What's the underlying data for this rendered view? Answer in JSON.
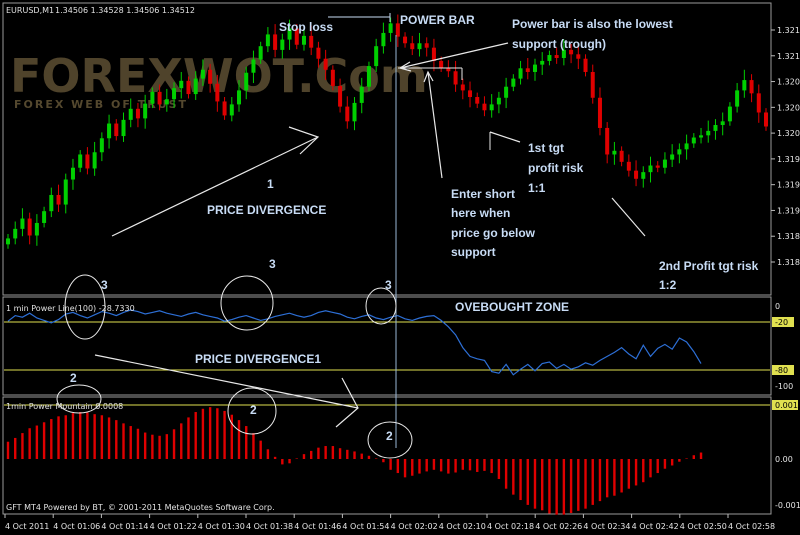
{
  "header": {
    "symbol": "EURUSD,M1",
    "ohlc": "1.34506 1.34528 1.34506 1.34512",
    "footer": "GFT MT4 Powered by BT, © 2001-2011 MetaQuotes Software Corp."
  },
  "watermark": {
    "main": "FOREXWOT.Com",
    "sub": "FOREX WEB OF TRUST"
  },
  "annotations": {
    "stop_loss": "Stop loss",
    "power_bar": "POWER BAR",
    "lowest_support_1": "Power bar is also the lowest",
    "lowest_support_2": "support (trough)",
    "first_tgt_1": "1st tgt",
    "first_tgt_2": "profit risk",
    "first_tgt_3": "1:1",
    "enter_1": "Enter short",
    "enter_2": "here when",
    "enter_3": "price go below",
    "enter_4": "support",
    "second_tgt_1": "2nd Profit tgt risk",
    "second_tgt_2": "1:2",
    "num_1": "1",
    "price_divergence": "PRICE DIVERGENCE",
    "num_3a": "3",
    "num_3b": "3",
    "num_3c": "3",
    "overbought": "OVEBOUGHT ZONE",
    "price_divergence1": "PRICE DIVERGENCE1",
    "num_2a": "2",
    "num_2b": "2",
    "num_2c": "2"
  },
  "chart_data": [
    {
      "type": "candlestick",
      "title": "EURUSD,M1",
      "x_ticks": [
        "4 Oct 2011",
        "4 Oct 01:06",
        "4 Oct 01:14",
        "4 Oct 01:22",
        "4 Oct 01:30",
        "4 Oct 01:38",
        "4 Oct 01:46",
        "4 Oct 01:54",
        "4 Oct 02:02",
        "4 Oct 02:10",
        "4 Oct 02:18",
        "4 Oct 02:26",
        "4 Oct 02:34",
        "4 Oct 02:42",
        "4 Oct 02:50",
        "4 Oct 02:58"
      ],
      "y_ticks": [
        "1.32145",
        "1.32110",
        "1.32075",
        "1.32040",
        "1.32005",
        "1.31970",
        "1.31935",
        "1.31900",
        "1.31865",
        "1.31830"
      ],
      "up_color": "#00d000",
      "down_color": "#e00000",
      "close": [
        1.31862,
        1.31875,
        1.31889,
        1.31866,
        1.31883,
        1.31899,
        1.31921,
        1.31908,
        1.31942,
        1.31958,
        1.31976,
        1.31957,
        1.31979,
        1.31998,
        1.32018,
        1.32001,
        1.32023,
        1.32038,
        1.32025,
        1.32045,
        1.32061,
        1.32044,
        1.32051,
        1.32066,
        1.32076,
        1.32058,
        1.32079,
        1.32091,
        1.32072,
        1.32048,
        1.32029,
        1.32044,
        1.32063,
        1.32087,
        1.32105,
        1.32123,
        1.32139,
        1.32118,
        1.32132,
        1.32147,
        1.32125,
        1.32137,
        1.32121,
        1.32106,
        1.32091,
        1.32069,
        1.32041,
        1.32021,
        1.32046,
        1.32068,
        1.32096,
        1.32123,
        1.32141,
        1.32154,
        1.32136,
        1.32127,
        1.32119,
        1.32127,
        1.32121,
        1.32103,
        1.32094,
        1.32089,
        1.32071,
        1.32063,
        1.32054,
        1.32045,
        1.32036,
        1.32044,
        1.32053,
        1.32068,
        1.32079,
        1.32093,
        1.32088,
        1.32098,
        1.32103,
        1.32111,
        1.32107,
        1.32118,
        1.32112,
        1.32106,
        1.32088,
        1.32053,
        1.32012,
        1.31976,
        1.31981,
        1.31966,
        1.31954,
        1.31943,
        1.31952,
        1.31961,
        1.31958,
        1.31969,
        1.31976,
        1.31983,
        1.31991,
        1.31999,
        1.32002,
        1.32008,
        1.32016,
        1.32021,
        1.32041,
        1.32063,
        1.32077,
        1.32059,
        1.32033,
        1.32014
      ]
    },
    {
      "type": "line",
      "title": "1 min Power Line(100) -28.7330",
      "x_ticks_shared": true,
      "y_ticks": [
        "0",
        "-20",
        "-80",
        "-100"
      ],
      "levels": [
        -20,
        -80
      ],
      "ylim": [
        -100,
        0
      ],
      "values": [
        -19,
        -12,
        -14,
        -9,
        -15,
        -18,
        -21,
        -17,
        -10,
        -8,
        -12,
        -15,
        -11,
        -7,
        -9,
        -12,
        -8,
        -5,
        -7,
        -10,
        -8,
        -6,
        -9,
        -11,
        -13,
        -10,
        -8,
        -11,
        -13,
        -15,
        -19,
        -17,
        -14,
        -12,
        -15,
        -18,
        -16,
        -13,
        -11,
        -9,
        -12,
        -14,
        -12,
        -8,
        -6,
        -8,
        -10,
        -14,
        -16,
        -13,
        -11,
        -15,
        -17,
        -14,
        -12,
        -16,
        -18,
        -15,
        -13,
        -12,
        -18,
        -26,
        -36,
        -52,
        -63,
        -66,
        -68,
        -82,
        -84,
        -73,
        -86,
        -79,
        -73,
        -81,
        -72,
        -70,
        -78,
        -73,
        -79,
        -76,
        -71,
        -74,
        -68,
        -63,
        -58,
        -52,
        -60,
        -66,
        -49,
        -63,
        -53,
        -48,
        -54,
        -40,
        -45,
        -57,
        -72
      ]
    },
    {
      "type": "bar",
      "title": "1min Power Mountain 0.0008",
      "x_ticks_shared": true,
      "y_ticks": [
        "0.0017",
        "0.00",
        "-0.0016"
      ],
      "ylim": [
        -0.0016,
        0.0017
      ],
      "positive_color": "#e00000",
      "values": [
        0.00032,
        0.00039,
        0.00048,
        0.00057,
        0.00062,
        0.00068,
        0.00074,
        0.00079,
        0.00081,
        0.00085,
        0.00087,
        0.00086,
        0.00083,
        0.00081,
        0.00077,
        0.00072,
        0.00066,
        0.00061,
        0.00056,
        0.00049,
        0.00045,
        0.00043,
        0.00046,
        0.00055,
        0.00066,
        0.00077,
        0.00087,
        0.00093,
        0.00096,
        0.00094,
        0.00089,
        0.00082,
        0.00072,
        0.00061,
        0.00048,
        0.00034,
        0.00018,
        4e-05,
        -0.0001,
        -8e-05,
        1e-05,
        9e-05,
        0.00015,
        0.00021,
        0.00024,
        0.00024,
        0.0002,
        0.00017,
        0.00014,
        0.0001,
        6e-05,
        1e-05,
        -6e-05,
        -0.0002,
        -0.00026,
        -0.00034,
        -0.00031,
        -0.00027,
        -0.00023,
        -0.0002,
        -0.00023,
        -0.00027,
        -0.00025,
        -0.0002,
        -0.00021,
        -0.00024,
        -0.00022,
        -0.00026,
        -0.00037,
        -0.00055,
        -0.00066,
        -0.00076,
        -0.00085,
        -0.00092,
        -0.00095,
        -0.00101,
        -0.00103,
        -0.00103,
        -0.001,
        -0.00096,
        -0.00092,
        -0.00085,
        -0.00078,
        -0.00071,
        -0.00068,
        -0.00062,
        -0.00055,
        -0.00049,
        -0.00043,
        -0.00034,
        -0.00026,
        -0.00018,
        -0.00012,
        -5e-05,
        1e-05,
        7e-05,
        0.00012
      ]
    }
  ]
}
